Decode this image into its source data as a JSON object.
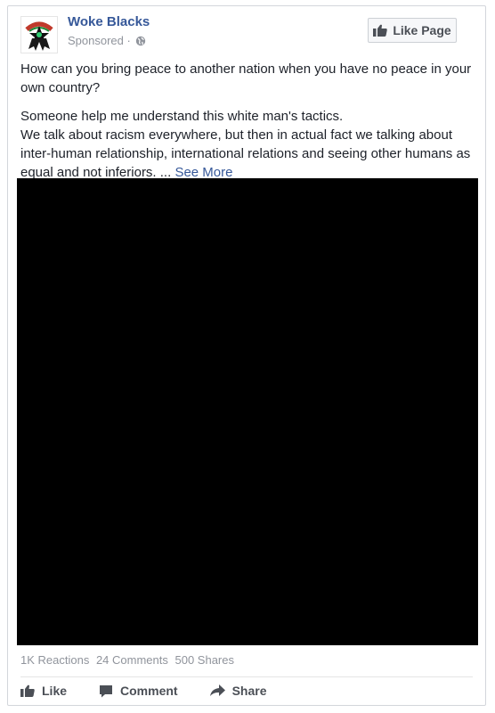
{
  "post": {
    "page_name": "Woke Blacks",
    "sponsored": "Sponsored ·",
    "like_page_label": "Like Page",
    "paragraph1": "How can you bring peace to another nation when you have no peace in your own country?",
    "paragraph2_lines": [
      "Someone help me understand this white man's tactics.",
      "We talk about racism everywhere, but then in actual fact we talking about inter-human relationship, international relations and seeing other humans as equal and not inferiors. ..."
    ],
    "see_more": "See More",
    "stats": {
      "reactions": "1K Reactions",
      "comments": "24 Comments",
      "shares": "500 Shares"
    },
    "actions": {
      "like": "Like",
      "comment": "Comment",
      "share": "Share"
    }
  },
  "icons": {
    "avatar": "woke-blacks-logo",
    "privacy": "globe-icon",
    "like_page": "thumbs-up-icon",
    "like": "thumbs-up-icon",
    "comment": "comment-bubble-icon",
    "share": "share-arrow-icon"
  },
  "colors": {
    "link": "#365899",
    "muted": "#90949c",
    "text": "#1d2129",
    "button_text": "#4b4f56",
    "media": "#000000"
  }
}
